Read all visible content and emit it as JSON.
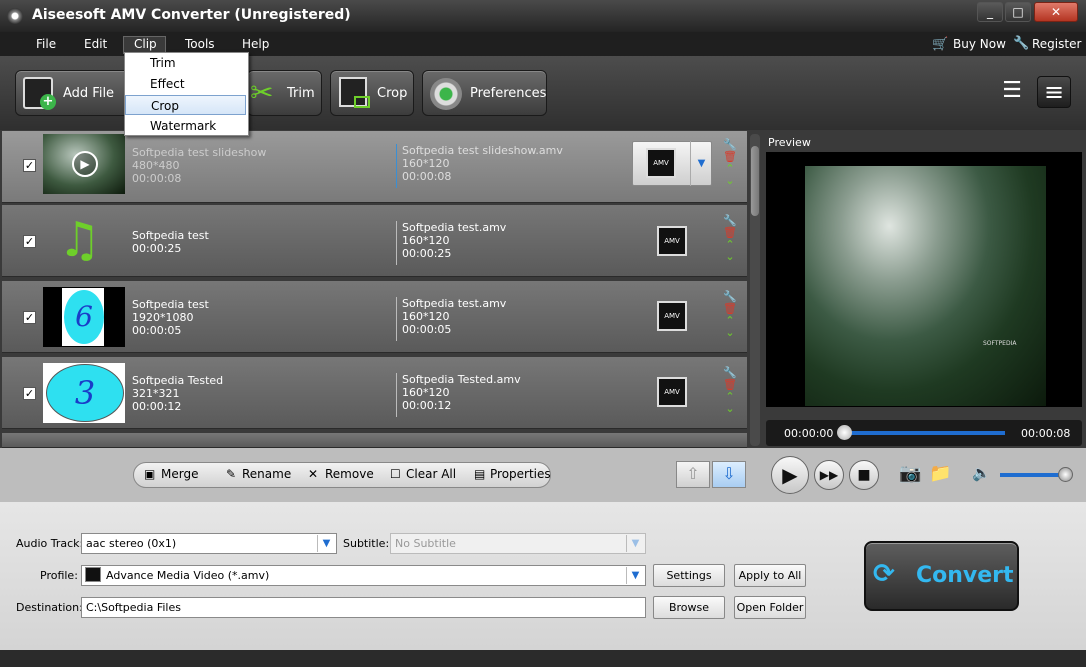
{
  "window": {
    "title": "Aiseesoft AMV Converter (Unregistered)",
    "minimize": "_",
    "maximize": "□",
    "close": "✕"
  },
  "menubar": {
    "items": [
      "File",
      "Edit",
      "Clip",
      "Tools",
      "Help"
    ],
    "buy_now": "Buy Now",
    "register": "Register"
  },
  "toolbar": {
    "add_file": "Add File",
    "trim": "Trim",
    "crop": "Crop",
    "preferences": "Preferences"
  },
  "clip_menu": {
    "items": [
      "Trim",
      "Effect",
      "Crop",
      "Watermark"
    ],
    "highlighted": "Crop"
  },
  "files": [
    {
      "name": "Softpedia test slideshow",
      "res": "480*480",
      "duration": "00:00:08",
      "out_name": "Softpedia test slideshow.amv",
      "out_res": "160*120",
      "out_duration": "00:00:08",
      "checked": true,
      "selected": true,
      "thumb": "forest-video",
      "format_badge": "AMV"
    },
    {
      "name": "Softpedia test",
      "res": "",
      "duration": "00:00:25",
      "out_name": "Softpedia test.amv",
      "out_res": "160*120",
      "out_duration": "00:00:25",
      "checked": true,
      "selected": false,
      "thumb": "music-note",
      "format_badge": "AMV"
    },
    {
      "name": "Softpedia test",
      "res": "1920*1080",
      "duration": "00:00:05",
      "out_name": "Softpedia test.amv",
      "out_res": "160*120",
      "out_duration": "00:00:05",
      "checked": true,
      "selected": false,
      "thumb": "number-6",
      "thumb_text": "6",
      "format_badge": "AMV"
    },
    {
      "name": "Softpedia Tested",
      "res": "321*321",
      "duration": "00:00:12",
      "out_name": "Softpedia Tested.amv",
      "out_res": "160*120",
      "out_duration": "00:00:12",
      "checked": true,
      "selected": false,
      "thumb": "number-3",
      "thumb_text": "3",
      "format_badge": "AMV"
    }
  ],
  "list_controls": {
    "merge": "Merge",
    "rename": "Rename",
    "remove": "Remove",
    "clear_all": "Clear All",
    "properties": "Properties"
  },
  "preview": {
    "label": "Preview",
    "current_time": "00:00:00",
    "total_time": "00:00:08",
    "watermark": "SOFTPEDIA",
    "progress": 0.0,
    "volume": 0.85
  },
  "settings": {
    "audio_track_label": "Audio Track:",
    "audio_track": "aac stereo (0x1)",
    "subtitle_label": "Subtitle:",
    "subtitle": "No Subtitle",
    "profile_label": "Profile:",
    "profile": "Advance Media Video (*.amv)",
    "destination_label": "Destination:",
    "destination": "C:\\Softpedia Files",
    "settings_btn": "Settings",
    "apply_all_btn": "Apply to All",
    "browse_btn": "Browse",
    "open_folder_btn": "Open Folder"
  },
  "convert": {
    "label": "Convert"
  },
  "colors": {
    "accent": "#1f6dd0",
    "convert_text": "#33b8f0",
    "wrench": "#6ecf2a",
    "trash": "#d93a2a"
  }
}
